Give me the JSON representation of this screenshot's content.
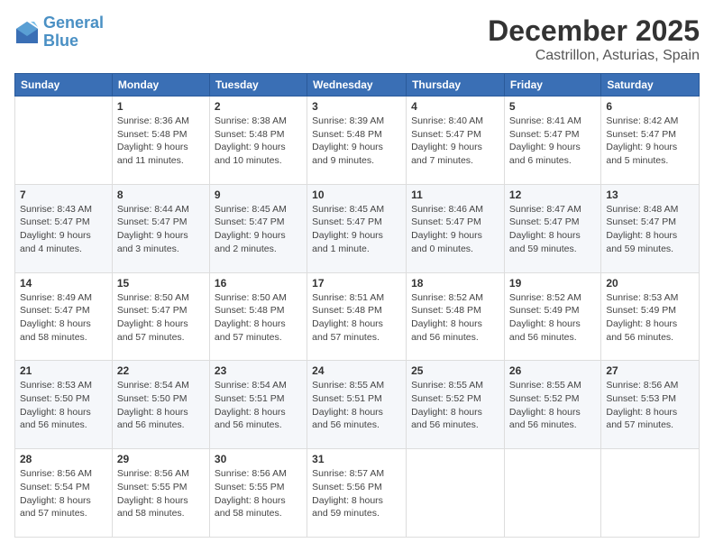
{
  "logo": {
    "line1": "General",
    "line2": "Blue"
  },
  "header": {
    "month": "December 2025",
    "location": "Castrillon, Asturias, Spain"
  },
  "weekdays": [
    "Sunday",
    "Monday",
    "Tuesday",
    "Wednesday",
    "Thursday",
    "Friday",
    "Saturday"
  ],
  "weeks": [
    [
      {
        "day": "",
        "sunrise": "",
        "sunset": "",
        "daylight": ""
      },
      {
        "day": "1",
        "sunrise": "Sunrise: 8:36 AM",
        "sunset": "Sunset: 5:48 PM",
        "daylight": "Daylight: 9 hours and 11 minutes."
      },
      {
        "day": "2",
        "sunrise": "Sunrise: 8:38 AM",
        "sunset": "Sunset: 5:48 PM",
        "daylight": "Daylight: 9 hours and 10 minutes."
      },
      {
        "day": "3",
        "sunrise": "Sunrise: 8:39 AM",
        "sunset": "Sunset: 5:48 PM",
        "daylight": "Daylight: 9 hours and 9 minutes."
      },
      {
        "day": "4",
        "sunrise": "Sunrise: 8:40 AM",
        "sunset": "Sunset: 5:47 PM",
        "daylight": "Daylight: 9 hours and 7 minutes."
      },
      {
        "day": "5",
        "sunrise": "Sunrise: 8:41 AM",
        "sunset": "Sunset: 5:47 PM",
        "daylight": "Daylight: 9 hours and 6 minutes."
      },
      {
        "day": "6",
        "sunrise": "Sunrise: 8:42 AM",
        "sunset": "Sunset: 5:47 PM",
        "daylight": "Daylight: 9 hours and 5 minutes."
      }
    ],
    [
      {
        "day": "7",
        "sunrise": "Sunrise: 8:43 AM",
        "sunset": "Sunset: 5:47 PM",
        "daylight": "Daylight: 9 hours and 4 minutes."
      },
      {
        "day": "8",
        "sunrise": "Sunrise: 8:44 AM",
        "sunset": "Sunset: 5:47 PM",
        "daylight": "Daylight: 9 hours and 3 minutes."
      },
      {
        "day": "9",
        "sunrise": "Sunrise: 8:45 AM",
        "sunset": "Sunset: 5:47 PM",
        "daylight": "Daylight: 9 hours and 2 minutes."
      },
      {
        "day": "10",
        "sunrise": "Sunrise: 8:45 AM",
        "sunset": "Sunset: 5:47 PM",
        "daylight": "Daylight: 9 hours and 1 minute."
      },
      {
        "day": "11",
        "sunrise": "Sunrise: 8:46 AM",
        "sunset": "Sunset: 5:47 PM",
        "daylight": "Daylight: 9 hours and 0 minutes."
      },
      {
        "day": "12",
        "sunrise": "Sunrise: 8:47 AM",
        "sunset": "Sunset: 5:47 PM",
        "daylight": "Daylight: 8 hours and 59 minutes."
      },
      {
        "day": "13",
        "sunrise": "Sunrise: 8:48 AM",
        "sunset": "Sunset: 5:47 PM",
        "daylight": "Daylight: 8 hours and 59 minutes."
      }
    ],
    [
      {
        "day": "14",
        "sunrise": "Sunrise: 8:49 AM",
        "sunset": "Sunset: 5:47 PM",
        "daylight": "Daylight: 8 hours and 58 minutes."
      },
      {
        "day": "15",
        "sunrise": "Sunrise: 8:50 AM",
        "sunset": "Sunset: 5:47 PM",
        "daylight": "Daylight: 8 hours and 57 minutes."
      },
      {
        "day": "16",
        "sunrise": "Sunrise: 8:50 AM",
        "sunset": "Sunset: 5:48 PM",
        "daylight": "Daylight: 8 hours and 57 minutes."
      },
      {
        "day": "17",
        "sunrise": "Sunrise: 8:51 AM",
        "sunset": "Sunset: 5:48 PM",
        "daylight": "Daylight: 8 hours and 57 minutes."
      },
      {
        "day": "18",
        "sunrise": "Sunrise: 8:52 AM",
        "sunset": "Sunset: 5:48 PM",
        "daylight": "Daylight: 8 hours and 56 minutes."
      },
      {
        "day": "19",
        "sunrise": "Sunrise: 8:52 AM",
        "sunset": "Sunset: 5:49 PM",
        "daylight": "Daylight: 8 hours and 56 minutes."
      },
      {
        "day": "20",
        "sunrise": "Sunrise: 8:53 AM",
        "sunset": "Sunset: 5:49 PM",
        "daylight": "Daylight: 8 hours and 56 minutes."
      }
    ],
    [
      {
        "day": "21",
        "sunrise": "Sunrise: 8:53 AM",
        "sunset": "Sunset: 5:50 PM",
        "daylight": "Daylight: 8 hours and 56 minutes."
      },
      {
        "day": "22",
        "sunrise": "Sunrise: 8:54 AM",
        "sunset": "Sunset: 5:50 PM",
        "daylight": "Daylight: 8 hours and 56 minutes."
      },
      {
        "day": "23",
        "sunrise": "Sunrise: 8:54 AM",
        "sunset": "Sunset: 5:51 PM",
        "daylight": "Daylight: 8 hours and 56 minutes."
      },
      {
        "day": "24",
        "sunrise": "Sunrise: 8:55 AM",
        "sunset": "Sunset: 5:51 PM",
        "daylight": "Daylight: 8 hours and 56 minutes."
      },
      {
        "day": "25",
        "sunrise": "Sunrise: 8:55 AM",
        "sunset": "Sunset: 5:52 PM",
        "daylight": "Daylight: 8 hours and 56 minutes."
      },
      {
        "day": "26",
        "sunrise": "Sunrise: 8:55 AM",
        "sunset": "Sunset: 5:52 PM",
        "daylight": "Daylight: 8 hours and 56 minutes."
      },
      {
        "day": "27",
        "sunrise": "Sunrise: 8:56 AM",
        "sunset": "Sunset: 5:53 PM",
        "daylight": "Daylight: 8 hours and 57 minutes."
      }
    ],
    [
      {
        "day": "28",
        "sunrise": "Sunrise: 8:56 AM",
        "sunset": "Sunset: 5:54 PM",
        "daylight": "Daylight: 8 hours and 57 minutes."
      },
      {
        "day": "29",
        "sunrise": "Sunrise: 8:56 AM",
        "sunset": "Sunset: 5:55 PM",
        "daylight": "Daylight: 8 hours and 58 minutes."
      },
      {
        "day": "30",
        "sunrise": "Sunrise: 8:56 AM",
        "sunset": "Sunset: 5:55 PM",
        "daylight": "Daylight: 8 hours and 58 minutes."
      },
      {
        "day": "31",
        "sunrise": "Sunrise: 8:57 AM",
        "sunset": "Sunset: 5:56 PM",
        "daylight": "Daylight: 8 hours and 59 minutes."
      },
      {
        "day": "",
        "sunrise": "",
        "sunset": "",
        "daylight": ""
      },
      {
        "day": "",
        "sunrise": "",
        "sunset": "",
        "daylight": ""
      },
      {
        "day": "",
        "sunrise": "",
        "sunset": "",
        "daylight": ""
      }
    ]
  ]
}
